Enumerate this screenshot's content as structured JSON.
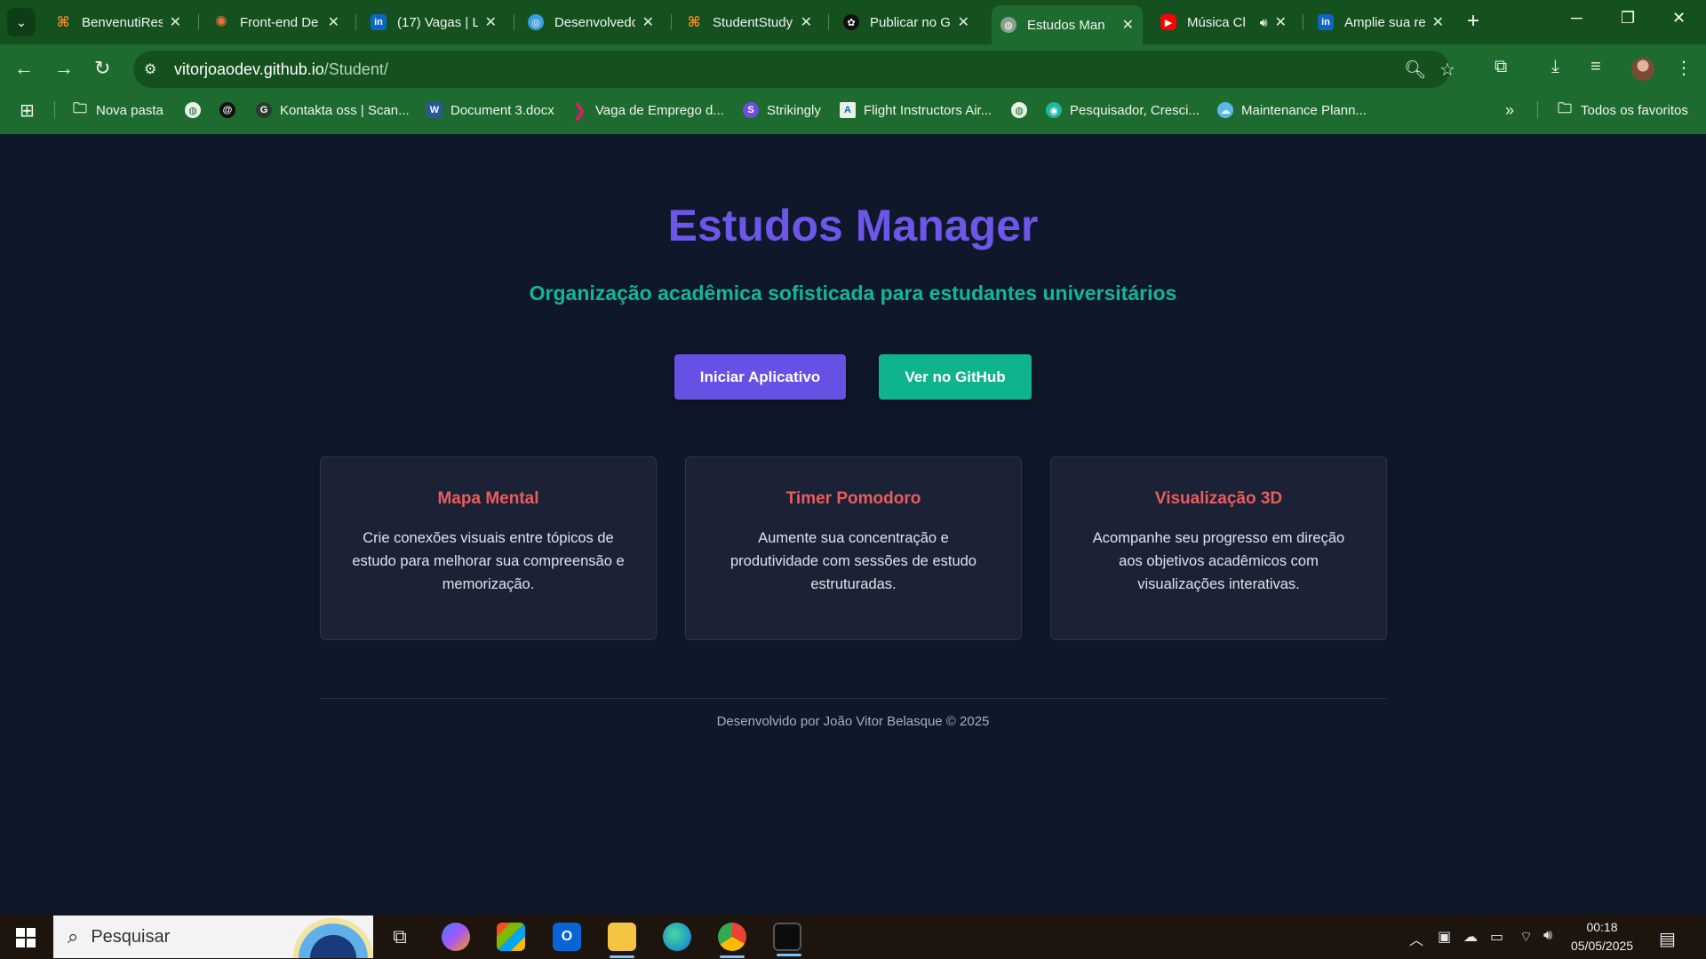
{
  "browser": {
    "tabs": [
      {
        "title": "BenvenutiRes",
        "favicon": "orange-connector-icon",
        "color": "#f08a24"
      },
      {
        "title": "Front-end De",
        "favicon": "starburst-icon",
        "color": "#e8743b"
      },
      {
        "title": "(17) Vagas | L",
        "favicon": "linkedin-icon",
        "color": "#0a66c2"
      },
      {
        "title": "Desenvolvedo",
        "favicon": "globe-blue-icon",
        "color": "#3b9fe0"
      },
      {
        "title": "StudentStudy",
        "favicon": "orange-connector-icon",
        "color": "#f08a24"
      },
      {
        "title": "Publicar no G",
        "favicon": "openai-icon",
        "color": "#111111"
      },
      {
        "title": "Estudos Man",
        "favicon": "globe-icon",
        "color": "#8aa08e"
      },
      {
        "title": "Música Cl",
        "favicon": "youtube-icon",
        "color": "#ff0000"
      },
      {
        "title": "Amplie sua re",
        "favicon": "linkedin-icon",
        "color": "#0a66c2"
      }
    ],
    "address": {
      "domain": "vitorjoaodev.github.io",
      "path": "/Student/"
    },
    "bookmarks": [
      {
        "label": "Nova pasta",
        "icon": "folder-icon"
      },
      {
        "label": "",
        "icon": "globe-icon"
      },
      {
        "label": "",
        "icon": "threads-icon"
      },
      {
        "label": "Kontakta oss | Scan...",
        "icon": "google-icon"
      },
      {
        "label": "Document 3.docx",
        "icon": "word-icon"
      },
      {
        "label": "Vaga de Emprego d...",
        "icon": "arrow-brand-icon"
      },
      {
        "label": "Strikingly",
        "icon": "strikingly-icon"
      },
      {
        "label": "Flight Instructors Air...",
        "icon": "flight-icon"
      },
      {
        "label": "",
        "icon": "globe-icon"
      },
      {
        "label": "Pesquisador, Cresci...",
        "icon": "teal-circle-icon"
      },
      {
        "label": "Maintenance Plann...",
        "icon": "cloud-icon"
      }
    ],
    "all_bookmarks_label": "Todos os favoritos"
  },
  "page": {
    "title": "Estudos Manager",
    "subtitle": "Organização acadêmica sofisticada para estudantes universitários",
    "primary_button": "Iniciar Aplicativo",
    "secondary_button": "Ver no GitHub",
    "features": [
      {
        "title": "Mapa Mental",
        "description": "Crie conexões visuais entre tópicos de estudo para melhorar sua compreensão e memorização."
      },
      {
        "title": "Timer Pomodoro",
        "description": "Aumente sua concentração e produtividade com sessões de estudo estruturadas."
      },
      {
        "title": "Visualização 3D",
        "description": "Acompanhe seu progresso em direção aos objetivos acadêmicos com visualizações interativas."
      }
    ],
    "footer": "Desenvolvido por João Vitor Belasque © 2025"
  },
  "taskbar": {
    "search_placeholder": "Pesquisar",
    "time": "00:18",
    "date": "05/05/2025"
  },
  "colors": {
    "accent_purple": "#6c57e8",
    "accent_teal": "#11b893",
    "card_title": "#ea5d5d",
    "background": "#0f172a"
  }
}
